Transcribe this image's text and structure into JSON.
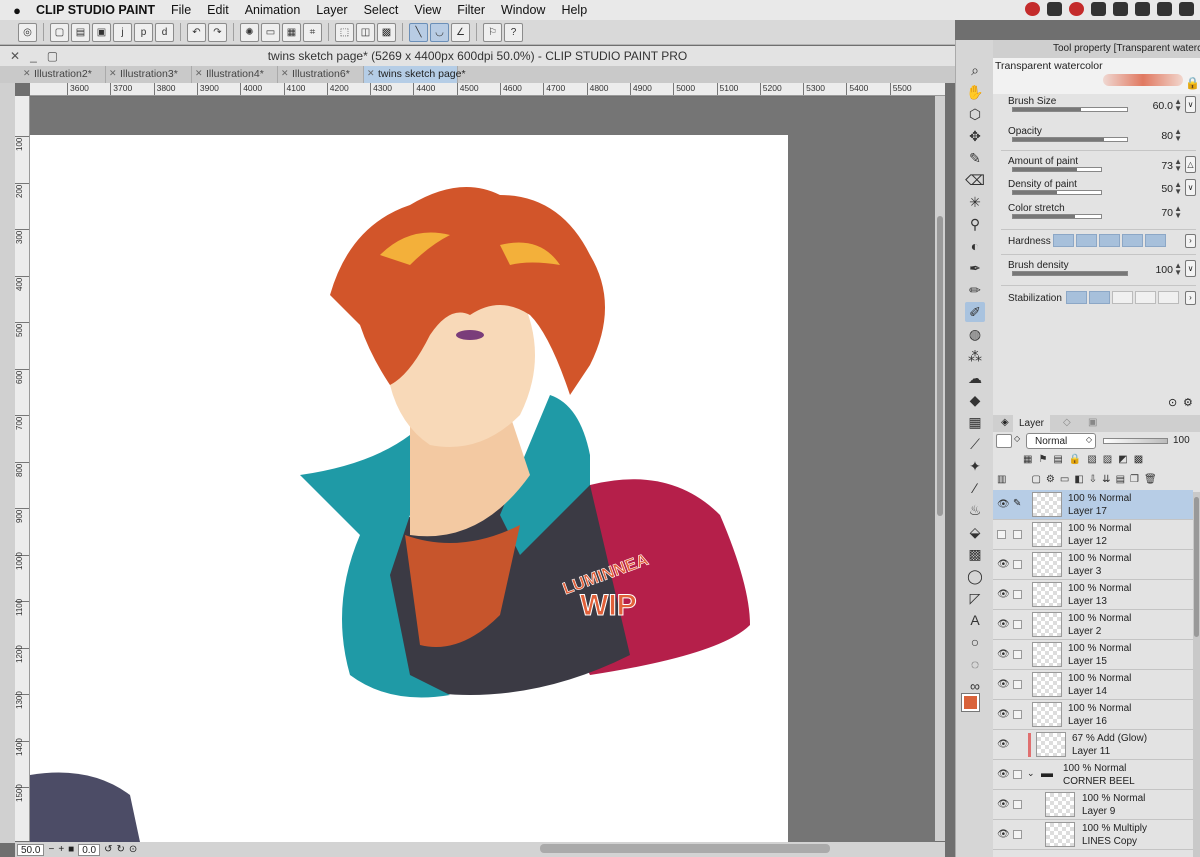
{
  "menubar": {
    "app": "CLIP STUDIO PAINT",
    "items": [
      "File",
      "Edit",
      "Animation",
      "Layer",
      "Select",
      "View",
      "Filter",
      "Window",
      "Help"
    ]
  },
  "window": {
    "title": "twins sketch page* (5269 x 4400px 600dpi 50.0%)  - CLIP STUDIO PAINT PRO"
  },
  "tabs": [
    {
      "label": "Illustration2*"
    },
    {
      "label": "Illustration3*"
    },
    {
      "label": "Illustration4*"
    },
    {
      "label": "Illustration6*"
    },
    {
      "label": "twins sketch page*"
    }
  ],
  "ruler": {
    "h_ticks": [
      "3600",
      "3700",
      "3800",
      "3900",
      "4000",
      "4100",
      "4200",
      "4300",
      "4400",
      "4500",
      "4600",
      "4700",
      "4800",
      "4900",
      "5000",
      "5100",
      "5200",
      "5300",
      "5400",
      "5500"
    ],
    "v_ticks": [
      "100",
      "200",
      "300",
      "400",
      "500",
      "600",
      "700",
      "800",
      "900",
      "1000",
      "1100",
      "1200",
      "1300",
      "1400",
      "1500"
    ]
  },
  "canvas": {
    "watermark_line1": "LUMINNEA",
    "watermark_line2": "WIP"
  },
  "status": {
    "zoom": "50.0",
    "rotation": "0.0"
  },
  "tool_property": {
    "header": "Tool property [Transparent watercolo",
    "preset": "Transparent watercolor",
    "props": {
      "brush_size": {
        "label": "Brush Size",
        "value": "60.0",
        "fill": 0.6
      },
      "opacity": {
        "label": "Opacity",
        "value": "80",
        "fill": 0.8
      },
      "amount_of_paint": {
        "label": "Amount of paint",
        "value": "73",
        "fill": 0.73
      },
      "density_of_paint": {
        "label": "Density of paint",
        "value": "50",
        "fill": 0.5
      },
      "color_stretch": {
        "label": "Color stretch",
        "value": "70",
        "fill": 0.7
      },
      "hardness": {
        "label": "Hardness",
        "filled": 5
      },
      "brush_density": {
        "label": "Brush density",
        "value": "100",
        "fill": 1.0
      },
      "stabilization": {
        "label": "Stabilization",
        "filled": 2
      }
    }
  },
  "layer_panel": {
    "tab": "Layer",
    "blend_mode": "Normal",
    "opacity": "100",
    "layers": [
      {
        "line1": "100 % Normal",
        "line2": "Layer 17",
        "visible": true,
        "selected": true
      },
      {
        "line1": "100 % Normal",
        "line2": "Layer 12",
        "visible": false,
        "selected": false
      },
      {
        "line1": "100 % Normal",
        "line2": "Layer 3",
        "visible": true,
        "selected": false
      },
      {
        "line1": "100 % Normal",
        "line2": "Layer 13",
        "visible": true,
        "selected": false
      },
      {
        "line1": "100 % Normal",
        "line2": "Layer 2",
        "visible": true,
        "selected": false
      },
      {
        "line1": "100 % Normal",
        "line2": "Layer 15",
        "visible": true,
        "selected": false
      },
      {
        "line1": "100 % Normal",
        "line2": "Layer 14",
        "visible": true,
        "selected": false
      },
      {
        "line1": "100 % Normal",
        "line2": "Layer 16",
        "visible": true,
        "selected": false
      },
      {
        "line1": "67 % Add (Glow)",
        "line2": "Layer 11",
        "visible": true,
        "selected": false
      },
      {
        "line1": "100 % Normal",
        "line2": "CORNER BEEL",
        "visible": true,
        "selected": false
      },
      {
        "line1": "100 % Normal",
        "line2": "Layer 9",
        "visible": true,
        "selected": false
      },
      {
        "line1": "100 % Multiply",
        "line2": "LINES Copy",
        "visible": true,
        "selected": false
      }
    ]
  },
  "colors": {
    "main": "#d9623a",
    "sub": "#f2b7b7",
    "accent_selection": "#b7cde6"
  }
}
